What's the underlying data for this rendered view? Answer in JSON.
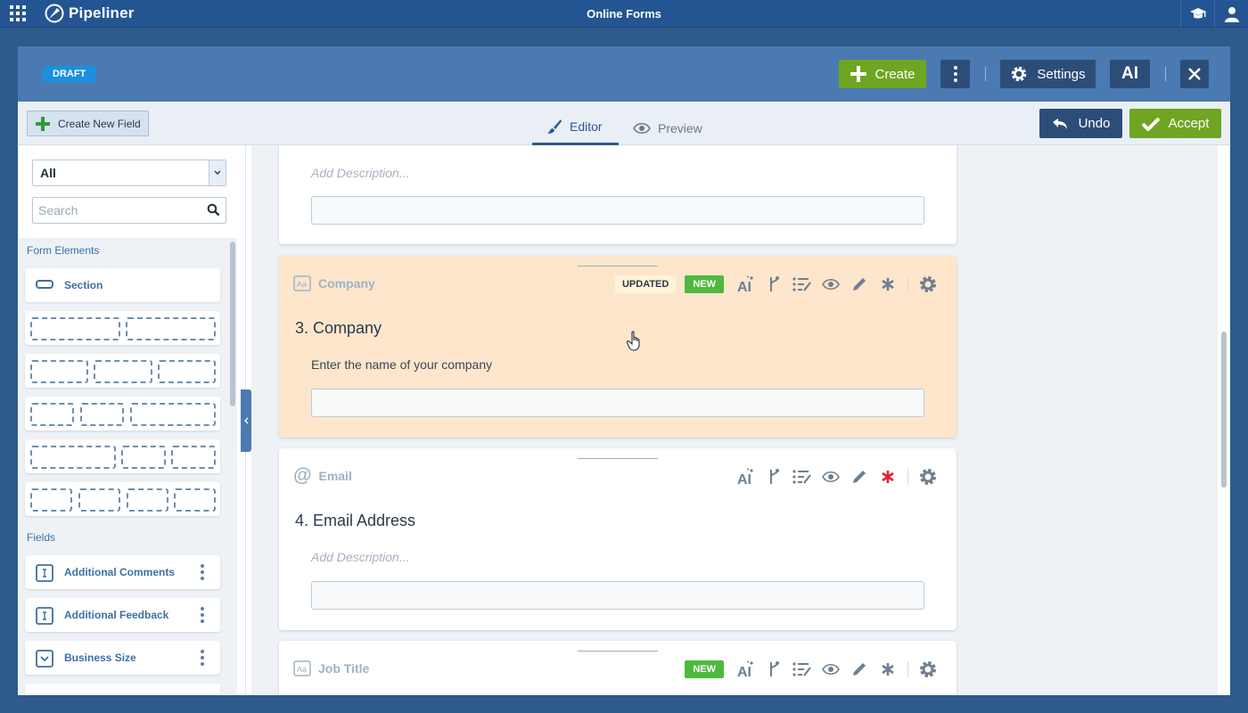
{
  "appbar": {
    "logo_text": "Pipeliner",
    "title": "Online Forms",
    "icons": [
      "apps-grid-icon",
      "graduation-cap-icon",
      "user-icon"
    ]
  },
  "header": {
    "status_badge": "DRAFT",
    "create_label": "Create",
    "settings_label": "Settings",
    "ai_label": "AI"
  },
  "toolbar": {
    "new_field_label": "Create New Field",
    "tabs": [
      {
        "label": "Editor",
        "active": true
      },
      {
        "label": "Preview",
        "active": false
      }
    ],
    "undo_label": "Undo",
    "accept_label": "Accept"
  },
  "sidebar": {
    "filter_value": "All",
    "search_placeholder": "Search",
    "form_elements_heading": "Form Elements",
    "section_label": "Section",
    "fields_heading": "Fields",
    "fields": [
      {
        "label": "Additional Comments",
        "icon": "text-field-icon"
      },
      {
        "label": "Additional Feedback",
        "icon": "text-field-icon"
      },
      {
        "label": "Business Size",
        "icon": "dropdown-field-icon"
      }
    ]
  },
  "form": {
    "prev_card": {
      "description_placeholder": "Add Description..."
    },
    "company": {
      "type_label": "Company",
      "badge_updated": "UPDATED",
      "badge_new": "NEW",
      "title": "3. Company",
      "description": "Enter the name of your company"
    },
    "email": {
      "type_label": "Email",
      "title": "4. Email Address",
      "description_placeholder": "Add Description..."
    },
    "job_title": {
      "type_label": "Job Title",
      "badge_new": "NEW"
    }
  },
  "colors": {
    "appbar": "#245593",
    "header": "#4a7ab1",
    "primary_button": "#2c4d78",
    "green_button": "#6fa522",
    "active_card": "#fde6cc",
    "required_red": "#e0202e"
  }
}
